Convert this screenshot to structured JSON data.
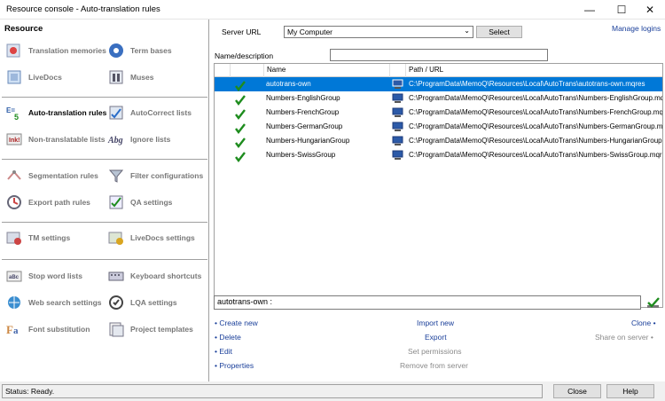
{
  "window": {
    "title": "Resource console - Auto-translation rules",
    "min": "—",
    "max": "☐",
    "close": "✕"
  },
  "left": {
    "header": "Resource",
    "groups": [
      [
        {
          "label": "Translation memories",
          "icon": "tm-icon"
        },
        {
          "label": "Term bases",
          "icon": "termbase-icon"
        },
        {
          "label": "LiveDocs",
          "icon": "livedocs-icon"
        },
        {
          "label": "Muses",
          "icon": "muses-icon"
        }
      ],
      [
        {
          "label": "Auto-translation rules",
          "icon": "autotrans-icon",
          "active": true
        },
        {
          "label": "AutoCorrect lists",
          "icon": "autocorrect-icon"
        },
        {
          "label": "Non-translatable lists",
          "icon": "nontranslatable-icon"
        },
        {
          "label": "Ignore lists",
          "icon": "ignore-icon"
        }
      ],
      [
        {
          "label": "Segmentation rules",
          "icon": "segmentation-icon"
        },
        {
          "label": "Filter configurations",
          "icon": "filter-icon"
        },
        {
          "label": "Export path rules",
          "icon": "exportpath-icon"
        },
        {
          "label": "QA settings",
          "icon": "qa-icon"
        }
      ],
      [
        {
          "label": "TM settings",
          "icon": "tmsettings-icon"
        },
        {
          "label": "LiveDocs settings",
          "icon": "livedocssettings-icon"
        }
      ],
      [
        {
          "label": "Stop word lists",
          "icon": "stopword-icon"
        },
        {
          "label": "Keyboard shortcuts",
          "icon": "keyboard-icon"
        },
        {
          "label": "Web search settings",
          "icon": "websearch-icon"
        },
        {
          "label": "LQA settings",
          "icon": "lqa-icon"
        },
        {
          "label": "Font substitution",
          "icon": "font-icon"
        },
        {
          "label": "Project templates",
          "icon": "projecttemplate-icon"
        }
      ]
    ]
  },
  "right": {
    "server_url_label": "Server URL",
    "server_url_value": "My Computer",
    "select_button": "Select",
    "manage_logins": "Manage logins",
    "name_desc_label": "Name/description",
    "name_desc_value": "",
    "columns": [
      "Name",
      "Path / URL"
    ],
    "rows": [
      {
        "name": "autotrans-own",
        "path": "C:\\ProgramData\\MemoQ\\Resources\\Local\\AutoTrans\\autotrans-own.mqres",
        "selected": true
      },
      {
        "name": "Numbers-EnglishGroup",
        "path": "C:\\ProgramData\\MemoQ\\Resources\\Local\\AutoTrans\\Numbers-EnglishGroup.mqres"
      },
      {
        "name": "Numbers-FrenchGroup",
        "path": "C:\\ProgramData\\MemoQ\\Resources\\Local\\AutoTrans\\Numbers-FrenchGroup.mqres"
      },
      {
        "name": "Numbers-GermanGroup",
        "path": "C:\\ProgramData\\MemoQ\\Resources\\Local\\AutoTrans\\Numbers-GermanGroup.mqres"
      },
      {
        "name": "Numbers-HungarianGroup",
        "path": "C:\\ProgramData\\MemoQ\\Resources\\Local\\AutoTrans\\Numbers-HungarianGroup...."
      },
      {
        "name": "Numbers-SwissGroup",
        "path": "C:\\ProgramData\\MemoQ\\Resources\\Local\\AutoTrans\\Numbers-SwissGroup.mqres"
      }
    ],
    "detail_text": "autotrans-own :",
    "actions": {
      "create_new": "• Create new",
      "delete": "• Delete",
      "edit": "• Edit",
      "properties": "• Properties",
      "import_new": "Import new",
      "export": "Export",
      "set_permissions": "Set permissions",
      "remove_from_server": "Remove from server",
      "clone": "Clone •",
      "share_on_server": "Share on server •"
    }
  },
  "status": {
    "text": "Status: Ready.",
    "close_button": "Close",
    "help_button": "Help"
  },
  "colors": {
    "selection": "#0078d7",
    "link": "#1a3f9a",
    "check": "#1e8c1e"
  }
}
